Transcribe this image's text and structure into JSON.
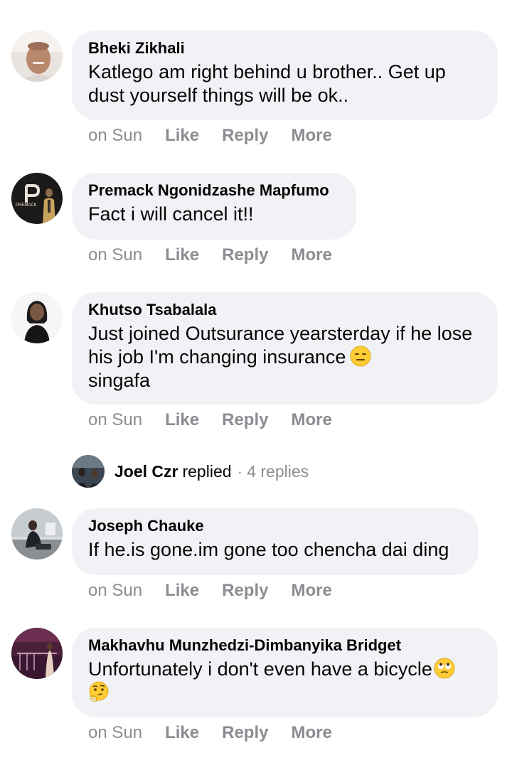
{
  "comments": [
    {
      "author": "Bheki Zikhali",
      "text": "Katlego am right behind u brother.. Get up dust yourself things will be ok..",
      "time": "on Sun",
      "like": "Like",
      "reply": "Reply",
      "more": "More"
    },
    {
      "author": "Premack Ngonidzashe Mapfumo",
      "avatar_text": "PREMACK",
      "text": "Fact i will cancel it!!",
      "time": "on Sun",
      "like": "Like",
      "reply": "Reply",
      "more": "More"
    },
    {
      "author": "Khutso Tsabalala",
      "text": "Just joined Outsurance yearsterday if he lose his job I'm changing insurance",
      "text_tail": "singafa",
      "emoji": "expressionless-face-emoji",
      "time": "on Sun",
      "like": "Like",
      "reply": "Reply",
      "more": "More"
    },
    {
      "author": "Joseph Chauke",
      "text": "If he.is gone.im gone too chencha dai ding",
      "time": "on Sun",
      "like": "Like",
      "reply": "Reply",
      "more": "More"
    },
    {
      "author": "Makhavhu Munzhedzi-Dimbanyika Bridget",
      "text": "Unfortunately i don't even have a bicycle",
      "emojis": [
        "eye-roll-face-emoji",
        "thinking-face-emoji"
      ],
      "time": "on Sun",
      "like": "Like",
      "reply": "Reply",
      "more": "More"
    }
  ],
  "reply_summary": {
    "name": "Joel Czr",
    "verb": "replied",
    "separator": "·",
    "count": "4 replies"
  },
  "colors": {
    "bubble": "#f0f2f5",
    "meta": "#8a8d91",
    "text": "#050505"
  }
}
